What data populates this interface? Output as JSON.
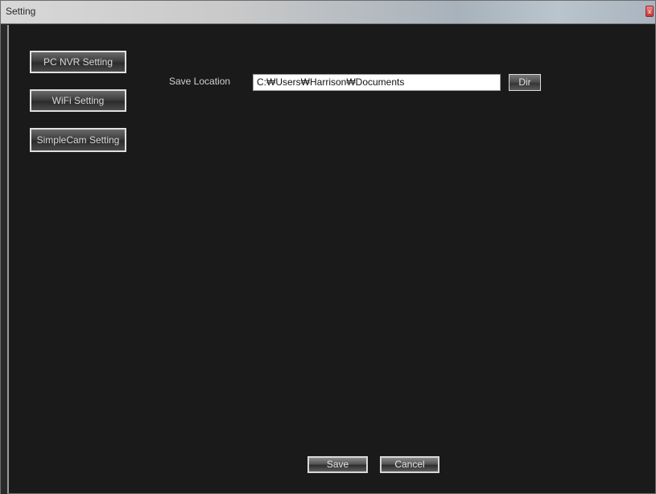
{
  "window": {
    "title": "Setting",
    "close_label": "x"
  },
  "sidebar": {
    "items": [
      {
        "label": "PC NVR Setting"
      },
      {
        "label": "WiFi Setting"
      },
      {
        "label": "SimpleCam Setting"
      }
    ]
  },
  "main": {
    "save_location_label": "Save Location",
    "save_location_value": "C:₩Users₩Harrison₩Documents",
    "dir_button_label": "Dir"
  },
  "footer": {
    "save_label": "Save",
    "cancel_label": "Cancel"
  },
  "colors": {
    "background": "#1a1a1a",
    "button_border": "#e0e0e0",
    "text": "#d0d0d0"
  }
}
